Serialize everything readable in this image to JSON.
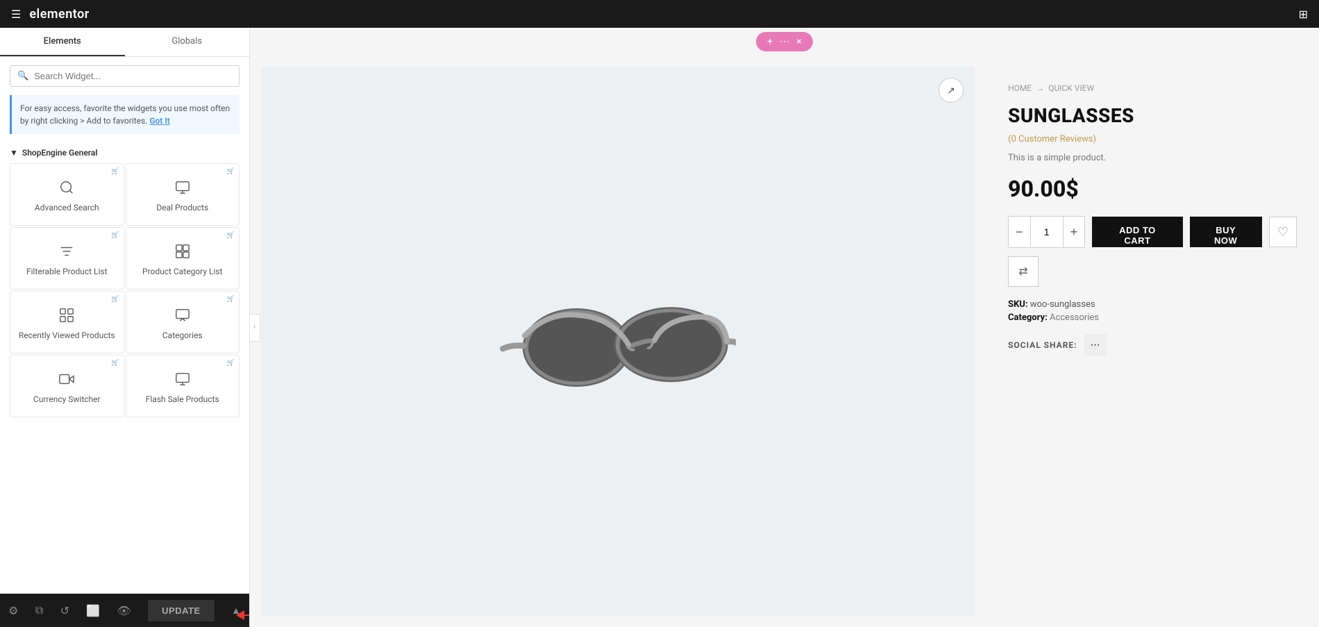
{
  "topbar": {
    "logo": "elementor",
    "hamburger_icon": "☰",
    "grid_icon": "⊞"
  },
  "sidebar": {
    "tabs": [
      {
        "label": "Elements",
        "active": true
      },
      {
        "label": "Globals",
        "active": false
      }
    ],
    "search_placeholder": "Search Widget...",
    "tip_text": "For easy access, favorite the widgets you use most often by right clicking > Add to favorites.",
    "tip_link": "Got It",
    "section_title": "ShopEngine General",
    "widgets": [
      {
        "label": "Advanced Search",
        "icon": "search"
      },
      {
        "label": "Deal Products",
        "icon": "box"
      },
      {
        "label": "Filterable Product List",
        "icon": "list"
      },
      {
        "label": "Product Category List",
        "icon": "box2"
      },
      {
        "label": "Recently Viewed Products",
        "icon": "grid"
      },
      {
        "label": "Categories",
        "icon": "box3"
      },
      {
        "label": "Currency Switcher",
        "icon": "camera"
      },
      {
        "label": "Flash Sale Products",
        "icon": "box4"
      }
    ]
  },
  "bottom_toolbar": {
    "settings_icon": "⚙",
    "layers_icon": "⧉",
    "history_icon": "↺",
    "responsive_icon": "⬜",
    "preview_icon": "👁",
    "update_label": "UPDATE",
    "arrow_icon": "▲"
  },
  "content": {
    "pink_bar": {
      "plus_icon": "+",
      "dots_icon": "⋯",
      "close_icon": "×"
    },
    "breadcrumb": {
      "home": "HOME",
      "arrow": "→",
      "current": "QUICK VIEW"
    },
    "product": {
      "title": "SUNGLASSES",
      "reviews": "(0 Customer Reviews)",
      "description": "This is a simple product.",
      "price": "90.00$",
      "quantity": "1",
      "add_to_cart": "ADD TO CART",
      "buy_now": "BUY NOW",
      "sku_label": "SKU:",
      "sku_value": "woo-sunglasses",
      "category_label": "Category:",
      "category_value": "Accessories",
      "social_share_label": "SOCIAL SHARE:"
    }
  }
}
